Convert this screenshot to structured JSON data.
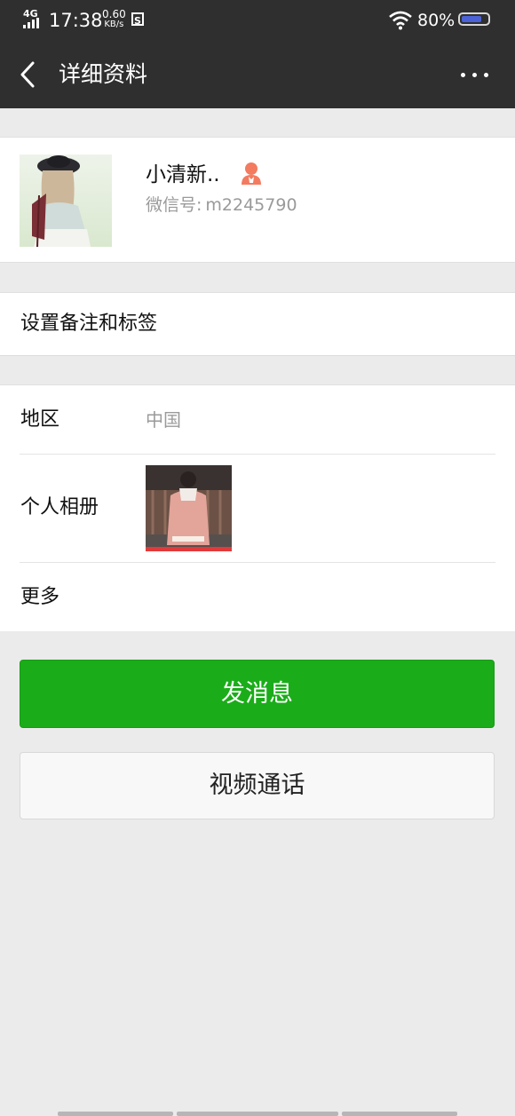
{
  "status_bar": {
    "network": "4G",
    "time": "17:38",
    "speed_value": "0.60",
    "speed_unit": "KB/s",
    "s_icon": "S",
    "battery_text": "80%",
    "battery_level": 0.8,
    "wifi_icon": "wifi-icon"
  },
  "nav": {
    "back_icon": "chevron-left-icon",
    "title": "详细资料",
    "more_icon": "more-dots-icon"
  },
  "profile": {
    "nickname": "小清新..",
    "gender_icon": "female-icon",
    "gender_color": "#f37b5f",
    "wechat_id_label": "微信号:",
    "wechat_id_value": "m2245790"
  },
  "remark": {
    "label": "设置备注和标签"
  },
  "info": {
    "region_label": "地区",
    "region_value": "中国",
    "album_label": "个人相册",
    "more_label": "更多"
  },
  "actions": {
    "send_message": "发消息",
    "video_call": "视频通话"
  },
  "colors": {
    "nav_bg": "#2f2f2f",
    "primary": "#1aad19",
    "page_bg": "#ebebeb"
  }
}
